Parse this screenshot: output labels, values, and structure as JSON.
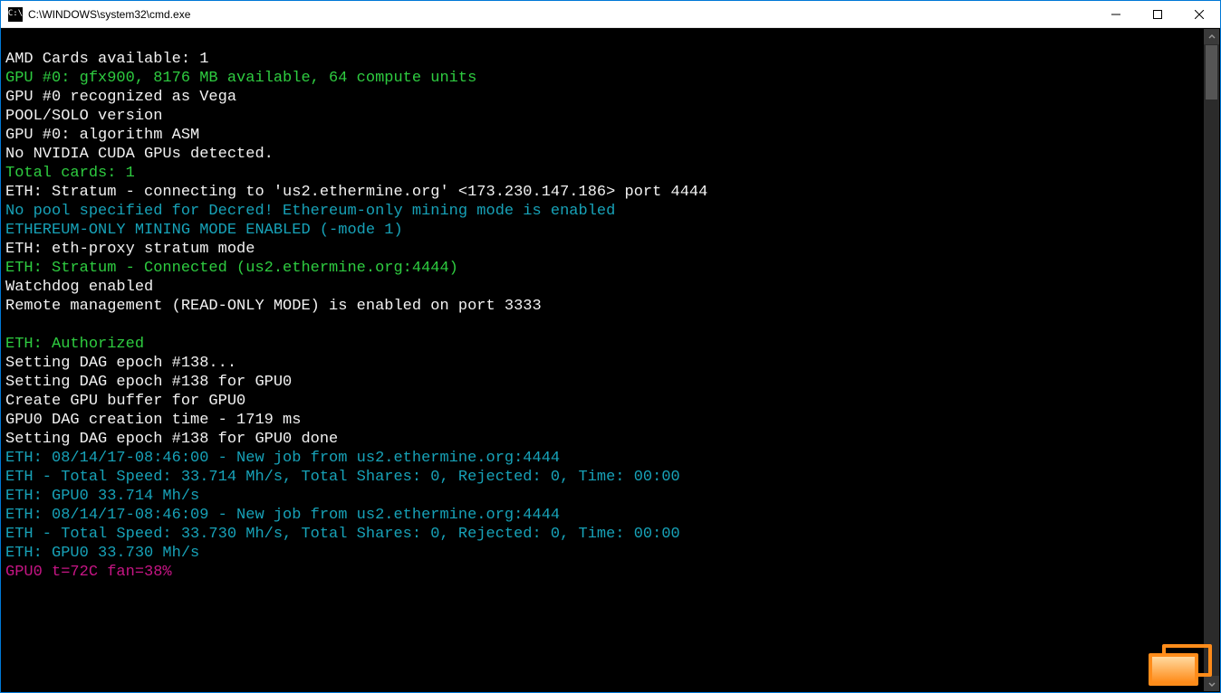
{
  "window": {
    "icon_text": "C:\\",
    "title": "C:\\WINDOWS\\system32\\cmd.exe"
  },
  "colors": {
    "white": "#f2f2f2",
    "gray": "#c0c0c0",
    "green": "#2ecc40",
    "cyan": "#17a2b8",
    "magenta": "#c71585"
  },
  "lines": [
    {
      "cls": "c-white",
      "text": ""
    },
    {
      "cls": "c-white",
      "text": "AMD Cards available: 1"
    },
    {
      "cls": "c-green",
      "text": "GPU #0: gfx900, 8176 MB available, 64 compute units"
    },
    {
      "cls": "c-white",
      "text": "GPU #0 recognized as Vega"
    },
    {
      "cls": "c-white",
      "text": "POOL/SOLO version"
    },
    {
      "cls": "c-white",
      "text": "GPU #0: algorithm ASM"
    },
    {
      "cls": "c-white",
      "text": "No NVIDIA CUDA GPUs detected."
    },
    {
      "cls": "c-green",
      "text": "Total cards: 1"
    },
    {
      "cls": "c-white",
      "text": "ETH: Stratum - connecting to 'us2.ethermine.org' <173.230.147.186> port 4444"
    },
    {
      "cls": "c-cyan",
      "text": "No pool specified for Decred! Ethereum-only mining mode is enabled"
    },
    {
      "cls": "c-cyan",
      "text": "ETHEREUM-ONLY MINING MODE ENABLED (-mode 1)"
    },
    {
      "cls": "c-white",
      "text": "ETH: eth-proxy stratum mode"
    },
    {
      "cls": "c-green",
      "text": "ETH: Stratum - Connected (us2.ethermine.org:4444)"
    },
    {
      "cls": "c-white",
      "text": "Watchdog enabled"
    },
    {
      "cls": "c-white",
      "text": "Remote management (READ-ONLY MODE) is enabled on port 3333"
    },
    {
      "cls": "c-white",
      "text": ""
    },
    {
      "cls": "c-green",
      "text": "ETH: Authorized"
    },
    {
      "cls": "c-white",
      "text": "Setting DAG epoch #138..."
    },
    {
      "cls": "c-white",
      "text": "Setting DAG epoch #138 for GPU0"
    },
    {
      "cls": "c-white",
      "text": "Create GPU buffer for GPU0"
    },
    {
      "cls": "c-white",
      "text": "GPU0 DAG creation time - 1719 ms"
    },
    {
      "cls": "c-white",
      "text": "Setting DAG epoch #138 for GPU0 done"
    },
    {
      "cls": "c-cyan",
      "text": "ETH: 08/14/17-08:46:00 - New job from us2.ethermine.org:4444"
    },
    {
      "cls": "c-cyan",
      "text": "ETH - Total Speed: 33.714 Mh/s, Total Shares: 0, Rejected: 0, Time: 00:00"
    },
    {
      "cls": "c-cyan",
      "text": "ETH: GPU0 33.714 Mh/s"
    },
    {
      "cls": "c-cyan",
      "text": "ETH: 08/14/17-08:46:09 - New job from us2.ethermine.org:4444"
    },
    {
      "cls": "c-cyan",
      "text": "ETH - Total Speed: 33.730 Mh/s, Total Shares: 0, Rejected: 0, Time: 00:00"
    },
    {
      "cls": "c-cyan",
      "text": "ETH: GPU0 33.730 Mh/s"
    },
    {
      "cls": "c-mag",
      "text": "GPU0 t=72C fan=38%"
    }
  ]
}
